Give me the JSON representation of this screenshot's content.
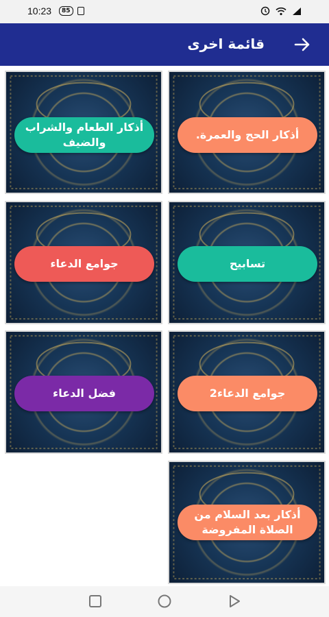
{
  "status": {
    "time": "10:23",
    "battery": "85"
  },
  "toolbar": {
    "title": "قائمة اخرى",
    "back_icon": "arrow-right-icon"
  },
  "cards": [
    {
      "label": "أذكار الحج والعمرة.",
      "color": "#fb8b66"
    },
    {
      "label": "أذكار الطعام والشراب والضيف",
      "color": "#1abc9c"
    },
    {
      "label": "تسابيح",
      "color": "#1abc9c"
    },
    {
      "label": "جوامع الدعاء",
      "color": "#ee5a57"
    },
    {
      "label": "جوامع الدعاء2",
      "color": "#fb8b66"
    },
    {
      "label": "فضل الدعاء",
      "color": "#7b2aa7"
    },
    {
      "label": "أذكار بعد السلام من الصلاة المفروضة",
      "color": "#fb8b66"
    }
  ],
  "navbar": {
    "recents_icon": "square-icon",
    "home_icon": "circle-icon",
    "back_icon": "triangle-back-icon"
  }
}
